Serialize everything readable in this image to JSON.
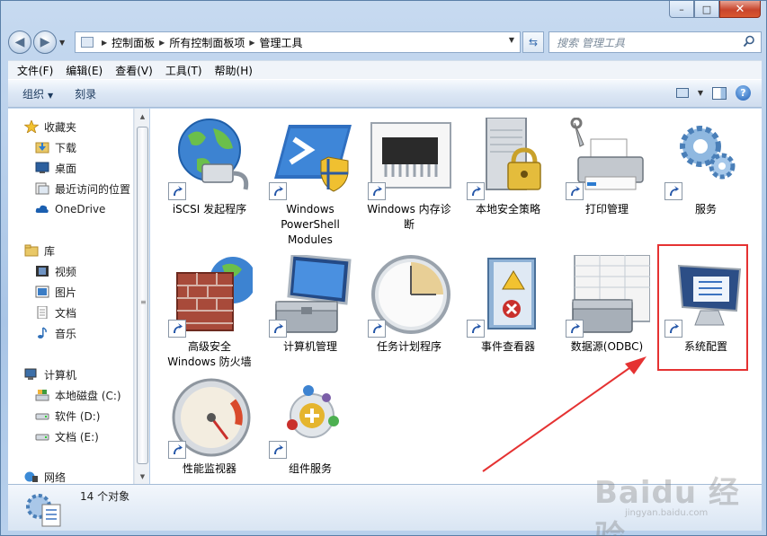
{
  "window": {
    "caption_buttons": {
      "minimize": "–",
      "maximize": "□",
      "close": "✕"
    }
  },
  "nav": {
    "back_icon": "back-arrow-icon",
    "forward_icon": "forward-arrow-icon",
    "breadcrumbs": [
      "控制面板",
      "所有控制面板项",
      "管理工具"
    ],
    "search_placeholder": "搜索 管理工具"
  },
  "menu": {
    "items": [
      "文件(F)",
      "编辑(E)",
      "查看(V)",
      "工具(T)",
      "帮助(H)"
    ]
  },
  "commands": {
    "organize": "组织",
    "burn": "刻录"
  },
  "sidebar": {
    "favorites": {
      "label": "收藏夹",
      "items": [
        "下载",
        "桌面",
        "最近访问的位置",
        "OneDrive"
      ]
    },
    "libraries": {
      "label": "库",
      "items": [
        "视频",
        "图片",
        "文档",
        "音乐"
      ]
    },
    "computer": {
      "label": "计算机",
      "items": [
        "本地磁盘 (C:)",
        "软件 (D:)",
        "文档 (E:)"
      ]
    },
    "network": {
      "label": "网络"
    }
  },
  "items": [
    {
      "label": "iSCSI 发起程序",
      "icon": "globe-network-icon"
    },
    {
      "label": "Windows PowerShell Modules",
      "icon": "powershell-icon"
    },
    {
      "label": "Windows 内存诊断",
      "icon": "memory-chip-icon"
    },
    {
      "label": "本地安全策略",
      "icon": "server-lock-icon"
    },
    {
      "label": "打印管理",
      "icon": "printer-icon"
    },
    {
      "label": "服务",
      "icon": "gears-icon"
    },
    {
      "label": "高级安全 Windows 防火墙",
      "icon": "firewall-icon"
    },
    {
      "label": "计算机管理",
      "icon": "computer-toolbox-icon"
    },
    {
      "label": "任务计划程序",
      "icon": "clock-icon"
    },
    {
      "label": "事件查看器",
      "icon": "event-log-icon"
    },
    {
      "label": "数据源(ODBC)",
      "icon": "database-toolbox-icon"
    },
    {
      "label": "系统配置",
      "icon": "system-config-monitor-icon"
    },
    {
      "label": "性能监视器",
      "icon": "gauge-icon"
    },
    {
      "label": "组件服务",
      "icon": "component-services-icon"
    }
  ],
  "status": {
    "count_text": "14 个对象"
  },
  "watermark": {
    "text": "Baidu 经验",
    "url_text": "jingyan.baidu.com"
  },
  "colors": {
    "highlight": "#e53232",
    "accent": "#1f5fb5"
  }
}
